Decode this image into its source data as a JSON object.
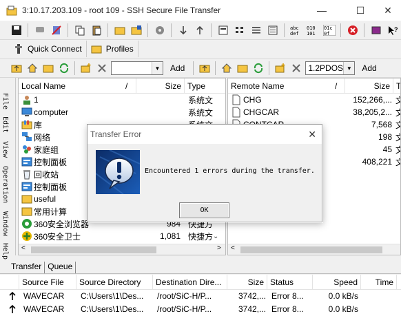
{
  "window": {
    "title": "3:10.17.203.109 - root 109 - SSH Secure File Transfer",
    "min_glyph": "—",
    "max_glyph": "☐",
    "close_glyph": "✕"
  },
  "quick_connect_label": "Quick Connect",
  "profiles_label": "Profiles",
  "local_toolbar": {
    "combo_value": "",
    "add_label": "Add"
  },
  "remote_toolbar": {
    "combo_value": "1.2PDOS",
    "add_label": "Add"
  },
  "side_tabs": [
    "File",
    "Edit",
    "View",
    "Operation",
    "Window",
    "Help"
  ],
  "local": {
    "headers": {
      "name": "Local Name",
      "size": "Size",
      "type": "Type"
    },
    "sort_glyph": "/",
    "rows": [
      {
        "icon": "user-folder-icon",
        "name": "1",
        "size": "",
        "type": "系统文"
      },
      {
        "icon": "computer-icon",
        "name": "computer",
        "size": "",
        "type": "系统文"
      },
      {
        "icon": "library-icon",
        "name": "库",
        "size": "",
        "type": "系统文"
      },
      {
        "icon": "network-icon",
        "name": "网络",
        "size": "",
        "type": ""
      },
      {
        "icon": "homegroup-icon",
        "name": "家庭组",
        "size": "",
        "type": ""
      },
      {
        "icon": "control-panel-icon",
        "name": "控制面板",
        "size": "",
        "type": ""
      },
      {
        "icon": "recycle-bin-icon",
        "name": "回收站",
        "size": "",
        "type": ""
      },
      {
        "icon": "control-panel-icon",
        "name": "控制面板",
        "size": "",
        "type": ""
      },
      {
        "icon": "folder-icon",
        "name": "useful",
        "size": "",
        "type": ""
      },
      {
        "icon": "folder-icon",
        "name": "常用计算",
        "size": "",
        "type": ""
      },
      {
        "icon": "browser-360-icon",
        "name": "360安全浏览器",
        "size": "984",
        "type": "快捷方"
      },
      {
        "icon": "guard-360-icon",
        "name": "360安全卫士",
        "size": "1,081",
        "type": "快捷方"
      }
    ]
  },
  "remote": {
    "headers": {
      "name": "Remote Name",
      "size": "Size",
      "type": "T"
    },
    "sort_glyph": "/",
    "rows": [
      {
        "name": "CHG",
        "size": "152,266,...",
        "type": "文"
      },
      {
        "name": "CHGCAR",
        "size": "38,205,2...",
        "type": "文"
      },
      {
        "name": "CONTCAR",
        "size": "7,568",
        "type": "文"
      },
      {
        "name": "",
        "size": "198",
        "type": "文"
      },
      {
        "name": "",
        "size": "45",
        "type": "文"
      },
      {
        "name": "",
        "size": "408,221",
        "type": "文"
      }
    ]
  },
  "bottom_tabs": [
    "Transfer",
    "Queue"
  ],
  "transfers": {
    "headers": {
      "source_file": "Source File",
      "source_dir": "Source Directory",
      "dest_dir": "Destination Dire...",
      "size": "Size",
      "status": "Status",
      "speed": "Speed",
      "time": "Time"
    },
    "rows": [
      {
        "source_file": "WAVECAR",
        "source_dir": "C:\\Users\\1\\Des...",
        "dest_dir": "/root/SiC-H/P...",
        "size": "3742,...",
        "status": "Error  8...",
        "speed": "0.0 kB/s",
        "time": ""
      },
      {
        "source_file": "WAVECAR",
        "source_dir": "C:\\Users\\1\\Des...",
        "dest_dir": "/root/SiC-H/P...",
        "size": "3742,...",
        "status": "Error  8...",
        "speed": "0.0 kB/s",
        "time": ""
      }
    ]
  },
  "dialog": {
    "title": "Transfer Error",
    "message": "Encountered 1 errors during the transfer.",
    "ok_label": "OK",
    "close_glyph": "✕"
  },
  "colors": {
    "accent": "#0a58a8",
    "error": "#d61f26",
    "folder": "#f5c542"
  }
}
